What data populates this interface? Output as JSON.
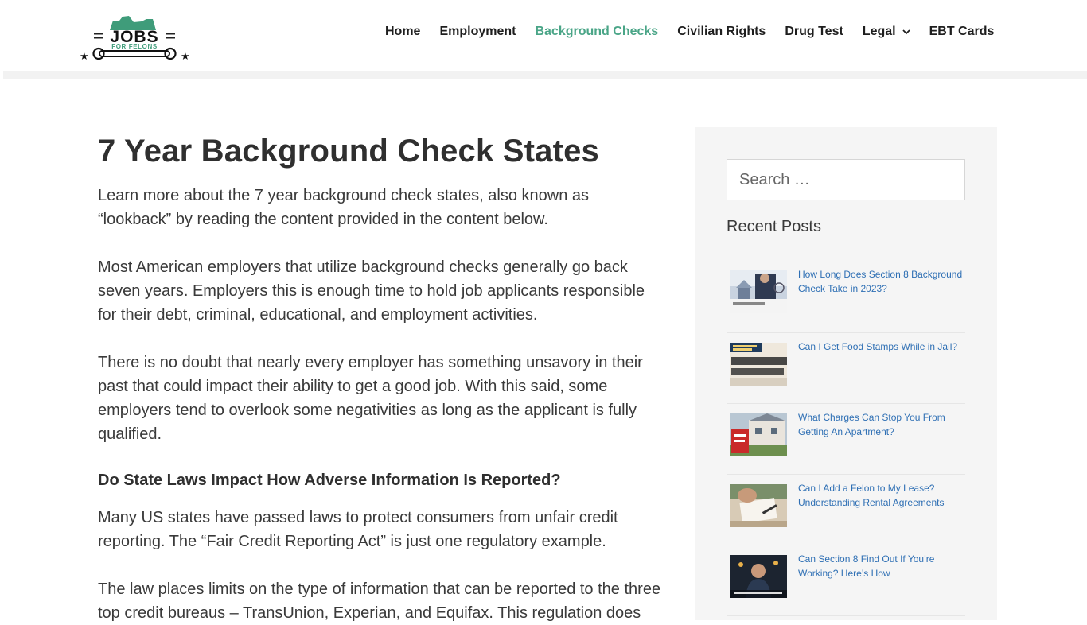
{
  "logo": {
    "text_main": "JOBS",
    "text_sub": "FOR FELONS"
  },
  "nav": [
    {
      "label": "Home",
      "active": false,
      "dropdown": false
    },
    {
      "label": "Employment",
      "active": false,
      "dropdown": false
    },
    {
      "label": "Background Checks",
      "active": true,
      "dropdown": false
    },
    {
      "label": "Civilian Rights",
      "active": false,
      "dropdown": false
    },
    {
      "label": "Drug Test",
      "active": false,
      "dropdown": false
    },
    {
      "label": "Legal",
      "active": false,
      "dropdown": true
    },
    {
      "label": "EBT Cards",
      "active": false,
      "dropdown": false
    }
  ],
  "article": {
    "title": "7 Year Background Check States",
    "p1": "Learn more about the 7 year background check states, also known as “lookback” by reading the content provided in the content below.",
    "p2": "Most American employers that utilize background checks generally go back seven years. Employers this is enough time to hold job applicants responsible for their debt, criminal, educational, and employment activities.",
    "p3": "There is no doubt that nearly every employer has something unsavory in their past that could impact their ability to get a good job. With this said, some employers tend to overlook some negativities as long as the applicant is fully qualified.",
    "subhead": "Do State Laws Impact How Adverse Information Is Reported?",
    "p4": "Many US states have passed laws to protect consumers from unfair credit reporting. The “Fair Credit Reporting Act” is just one regulatory example.",
    "p5": "The law places limits on the type of information that can be reported to the three top credit bureaus – TransUnion, Experian, and Equifax. This regulation does"
  },
  "sidebar": {
    "search_placeholder": "Search …",
    "recent_title": "Recent Posts",
    "posts": [
      {
        "title": "How Long Does Section 8 Background Check Take in 2023?",
        "thumb_icon": "section8-check-thumbnail"
      },
      {
        "title": "Can I Get Food Stamps While in Jail?",
        "thumb_icon": "food-stamps-application-thumbnail"
      },
      {
        "title": "What Charges Can Stop You From Getting An Apartment?",
        "thumb_icon": "for-rent-sign-thumbnail"
      },
      {
        "title": "Can I Add a Felon to My Lease? Understanding Rental Agreements",
        "thumb_icon": "lease-signing-thumbnail"
      },
      {
        "title": "Can Section 8 Find Out If You’re Working? Here’s How",
        "thumb_icon": "section8-working-thumbnail"
      }
    ]
  },
  "colors": {
    "accent": "#4aa587",
    "link": "#2e6fb4",
    "logo_green": "#3f9c7a",
    "text": "#3a3a3a"
  }
}
